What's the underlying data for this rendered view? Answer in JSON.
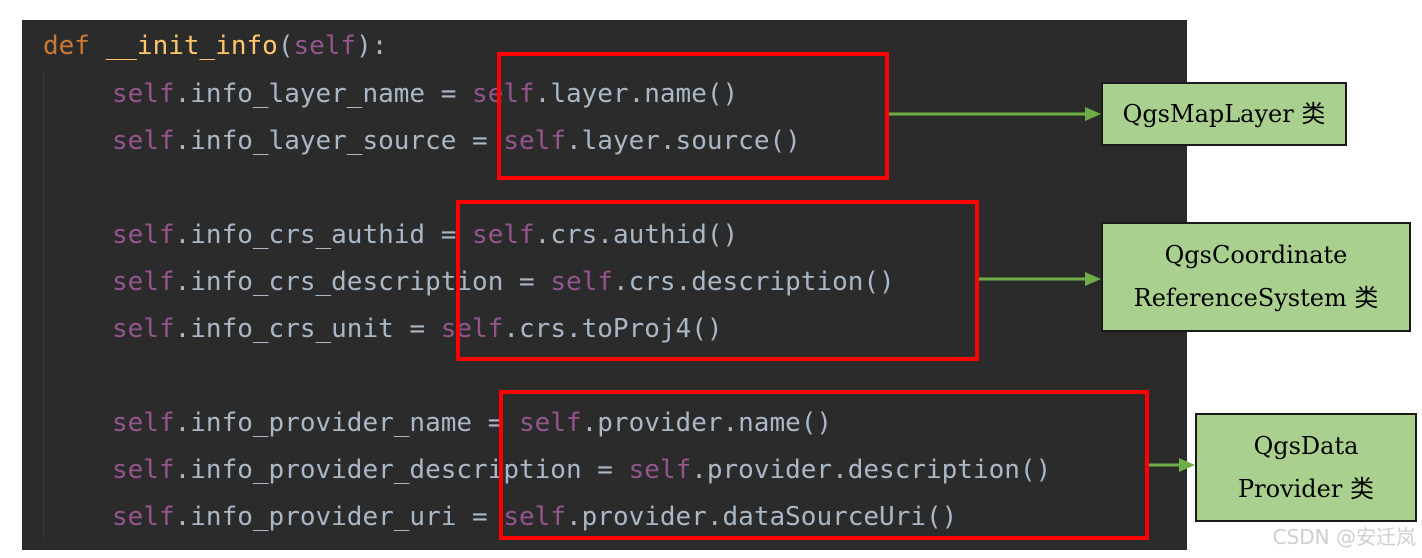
{
  "code": {
    "def_keyword": "def",
    "function_name": "__init_info",
    "signature_open": "(",
    "self_kw": "self",
    "signature_close": "):",
    "lines": [
      {
        "lhs": ".info_layer_name = ",
        "rhs": ".layer.name()"
      },
      {
        "lhs": ".info_layer_source = ",
        "rhs": ".layer.source()"
      },
      {
        "lhs": ".info_crs_authid = ",
        "rhs": ".crs.authid()"
      },
      {
        "lhs": ".info_crs_description = ",
        "rhs": ".crs.description()"
      },
      {
        "lhs": ".info_crs_unit = ",
        "rhs": ".crs.toProj4()"
      },
      {
        "lhs": ".info_provider_name = ",
        "rhs": ".provider.name()"
      },
      {
        "lhs": ".info_provider_description = ",
        "rhs": ".provider.description()"
      },
      {
        "lhs": ".info_provider_uri = ",
        "rhs": ".provider.dataSourceUri()"
      }
    ]
  },
  "annotations": [
    {
      "label": "QgsMapLayer 类"
    },
    {
      "label": "QgsCoordinate\nReferenceSystem 类"
    },
    {
      "label": "QgsData\nProvider 类"
    }
  ],
  "colors": {
    "editor_background": "#2b2b2b",
    "keyword": "#cc7832",
    "function_name": "#ffc66d",
    "self": "#94558d",
    "plain_code": "#a9b7c6",
    "highlight_border": "#ff0000",
    "class_box_fill": "#a9d08e",
    "arrow": "#70ad47"
  },
  "watermark": "CSDN @安迁岚"
}
